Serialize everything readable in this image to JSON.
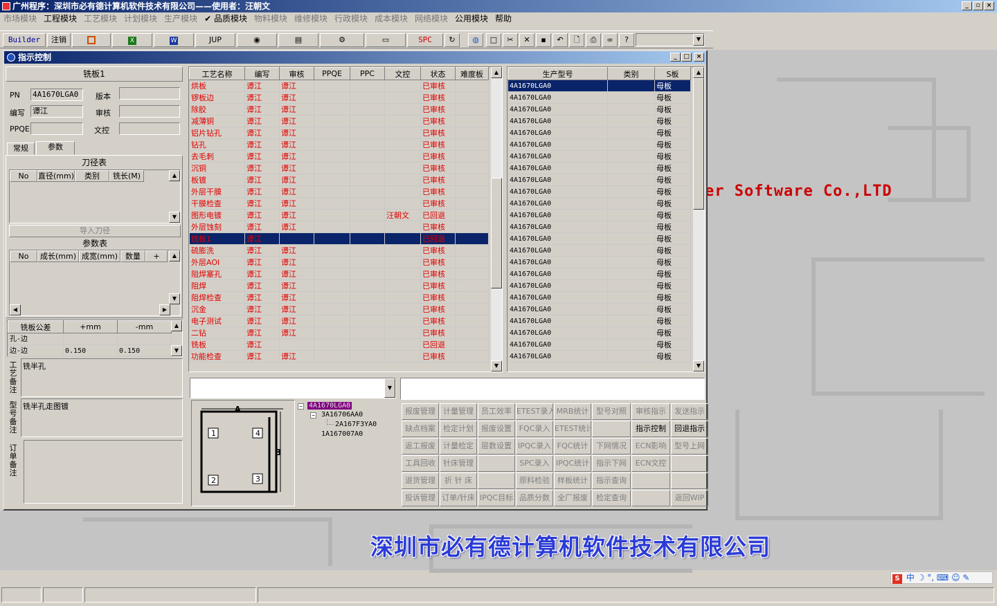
{
  "app": {
    "title": "广州程序：深圳市必有德计算机软件技术有限公司——使用者：汪朝文"
  },
  "menu": [
    {
      "label": "市场模块",
      "on": false
    },
    {
      "label": "工程模块",
      "on": true
    },
    {
      "label": "工艺模块",
      "on": false
    },
    {
      "label": "计划模块",
      "on": false
    },
    {
      "label": "生产模块",
      "on": false
    },
    {
      "label": "✔ 品质模块",
      "on": true
    },
    {
      "label": "物料模块",
      "on": false
    },
    {
      "label": "维修模块",
      "on": false
    },
    {
      "label": "行政模块",
      "on": false
    },
    {
      "label": "成本模块",
      "on": false
    },
    {
      "label": "网络模块",
      "on": false
    },
    {
      "label": "公用模块",
      "on": true
    },
    {
      "label": "帮助",
      "on": true
    }
  ],
  "toolbar": {
    "builder": "Builder",
    "logout": "注销",
    "jup": "JUP",
    "spc": "SPC"
  },
  "background": {
    "company_en": "er Software Co.,LTD",
    "company_cn": "深圳市必有德计算机软件技术有限公司"
  },
  "window": {
    "title": "指示控制"
  },
  "left": {
    "process_name": "铣板1",
    "pn_label": "PN",
    "pn_value": "4A1670LGA0",
    "version_label": "版本",
    "version_value": "",
    "editor_label": "编写",
    "editor_value": "谭江",
    "review_label": "审核",
    "review_value": "",
    "ppqe_label": "PPQE",
    "ppqe_value": "",
    "doc_label": "文控",
    "doc_value": "",
    "tabs": [
      "常规",
      "参数"
    ],
    "tool_table_title": "刀径表",
    "tool_headers": [
      "No",
      "直径(mm)",
      "类别",
      "铣长(M)"
    ],
    "import_btn": "导入刀径",
    "param_table_title": "参数表",
    "param_headers": [
      "No",
      "成长(mm)",
      "成宽(mm)",
      "数量",
      "+"
    ],
    "tol_headers": [
      "铣板公差",
      "+mm",
      "-mm"
    ],
    "tol_rows": [
      [
        "孔-边",
        "",
        ""
      ],
      [
        "边-边",
        "0.150",
        "0.150"
      ]
    ],
    "process_note_label": "工艺备注",
    "process_note": "铣半孔",
    "model_note_label": "型号备注",
    "model_note": "铣半孔走图镀",
    "order_note_label": "订单备注",
    "order_note": ""
  },
  "proc_table": {
    "headers": [
      "工艺名称",
      "编写",
      "审核",
      "PPQE",
      "PPC",
      "文控",
      "状态",
      "难度板"
    ],
    "rows": [
      [
        "烘板",
        "谭江",
        "谭江",
        "",
        "",
        "",
        "已审核",
        ""
      ],
      [
        "锣板边",
        "谭江",
        "谭江",
        "",
        "",
        "",
        "已审核",
        ""
      ],
      [
        "除胶",
        "谭江",
        "谭江",
        "",
        "",
        "",
        "已审核",
        ""
      ],
      [
        "减薄铜",
        "谭江",
        "谭江",
        "",
        "",
        "",
        "已审核",
        ""
      ],
      [
        "铝片钻孔",
        "谭江",
        "谭江",
        "",
        "",
        "",
        "已审核",
        ""
      ],
      [
        "钻孔",
        "谭江",
        "谭江",
        "",
        "",
        "",
        "已审核",
        ""
      ],
      [
        "去毛刺",
        "谭江",
        "谭江",
        "",
        "",
        "",
        "已审核",
        ""
      ],
      [
        "沉铜",
        "谭江",
        "谭江",
        "",
        "",
        "",
        "已审核",
        ""
      ],
      [
        "板镀",
        "谭江",
        "谭江",
        "",
        "",
        "",
        "已审核",
        ""
      ],
      [
        "外层干膜",
        "谭江",
        "谭江",
        "",
        "",
        "",
        "已审核",
        ""
      ],
      [
        "干膜检查",
        "谭江",
        "谭江",
        "",
        "",
        "",
        "已审核",
        ""
      ],
      [
        "图形电镀",
        "谭江",
        "谭江",
        "",
        "",
        "汪朝文",
        "已回退",
        ""
      ],
      [
        "外层蚀刻",
        "谭江",
        "谭江",
        "",
        "",
        "",
        "已审核",
        ""
      ],
      [
        "铣板1",
        "谭江",
        "",
        "",
        "",
        "",
        "已回退",
        ""
      ],
      [
        "硫膨洗",
        "谭江",
        "谭江",
        "",
        "",
        "",
        "已审核",
        ""
      ],
      [
        "外层AOI",
        "谭江",
        "谭江",
        "",
        "",
        "",
        "已审核",
        ""
      ],
      [
        "阻焊塞孔",
        "谭江",
        "谭江",
        "",
        "",
        "",
        "已审核",
        ""
      ],
      [
        "阻焊",
        "谭江",
        "谭江",
        "",
        "",
        "",
        "已审核",
        ""
      ],
      [
        "阻焊检查",
        "谭江",
        "谭江",
        "",
        "",
        "",
        "已审核",
        ""
      ],
      [
        "沉金",
        "谭江",
        "谭江",
        "",
        "",
        "",
        "已审核",
        ""
      ],
      [
        "电子测试",
        "谭江",
        "谭江",
        "",
        "",
        "",
        "已审核",
        ""
      ],
      [
        "二钻",
        "谭江",
        "谭江",
        "",
        "",
        "",
        "已审核",
        ""
      ],
      [
        "铣板",
        "谭江",
        "",
        "",
        "",
        "",
        "已回退",
        ""
      ],
      [
        "功能检查",
        "谭江",
        "谭江",
        "",
        "",
        "",
        "已审核",
        ""
      ]
    ],
    "selected": 13
  },
  "model_table": {
    "headers": [
      "生产型号",
      "类别",
      "S板"
    ],
    "rows": [
      [
        "4A1670LGA0",
        "",
        "母板"
      ],
      [
        "4A1670LGA0",
        "",
        "母板"
      ],
      [
        "4A1670LGA0",
        "",
        "母板"
      ],
      [
        "4A1670LGA0",
        "",
        "母板"
      ],
      [
        "4A1670LGA0",
        "",
        "母板"
      ],
      [
        "4A1670LGA0",
        "",
        "母板"
      ],
      [
        "4A1670LGA0",
        "",
        "母板"
      ],
      [
        "4A1670LGA0",
        "",
        "母板"
      ],
      [
        "4A1670LGA0",
        "",
        "母板"
      ],
      [
        "4A1670LGA0",
        "",
        "母板"
      ],
      [
        "4A1670LGA0",
        "",
        "母板"
      ],
      [
        "4A1670LGA0",
        "",
        "母板"
      ],
      [
        "4A1670LGA0",
        "",
        "母板"
      ],
      [
        "4A1670LGA0",
        "",
        "母板"
      ],
      [
        "4A1670LGA0",
        "",
        "母板"
      ],
      [
        "4A1670LGA0",
        "",
        "母板"
      ],
      [
        "4A1670LGA0",
        "",
        "母板"
      ],
      [
        "4A1670LGA0",
        "",
        "母板"
      ],
      [
        "4A1670LGA0",
        "",
        "母板"
      ],
      [
        "4A1670LGA0",
        "",
        "母板"
      ],
      [
        "4A1670LGA0",
        "",
        "母板"
      ],
      [
        "4A1670LGA0",
        "",
        "母板"
      ],
      [
        "4A1670LGA0",
        "",
        "母板"
      ],
      [
        "4A1670LGA0",
        "",
        "母板"
      ]
    ],
    "selected": 0
  },
  "diagram": {
    "a": "A",
    "b": "B",
    "corners": [
      "1",
      "4",
      "2",
      "3"
    ]
  },
  "tree": {
    "root": "4A1670LGA0",
    "children": [
      {
        "label": "3A16706AA0",
        "children": [
          {
            "label": "2A167F3YA0"
          }
        ]
      },
      {
        "label": "1A167007A0"
      }
    ]
  },
  "buttons": [
    [
      {
        "l": "报废管理",
        "on": false
      },
      {
        "l": "计量管理",
        "on": false
      },
      {
        "l": "员工效率",
        "on": false
      },
      {
        "l": "ETEST录入",
        "on": false
      },
      {
        "l": "MRB统计",
        "on": false
      },
      {
        "l": "型号对照",
        "on": false
      },
      {
        "l": "审核指示",
        "on": false
      },
      {
        "l": "发送指示",
        "on": false
      }
    ],
    [
      {
        "l": "缺点档案",
        "on": false
      },
      {
        "l": "检定计划",
        "on": false
      },
      {
        "l": "报废设置",
        "on": false
      },
      {
        "l": "FQC录入",
        "on": false
      },
      {
        "l": "ETEST统计",
        "on": false
      },
      {
        "l": "",
        "on": false
      },
      {
        "l": "指示控制",
        "on": true
      },
      {
        "l": "回退指示",
        "on": true
      }
    ],
    [
      {
        "l": "返工报废",
        "on": false
      },
      {
        "l": "计量检定",
        "on": false
      },
      {
        "l": "层数设置",
        "on": false
      },
      {
        "l": "IPQC录入",
        "on": false
      },
      {
        "l": "FQC统计",
        "on": false
      },
      {
        "l": "下网情况",
        "on": false
      },
      {
        "l": "ECN影响",
        "on": false
      },
      {
        "l": "型号上网",
        "on": false
      }
    ],
    [
      {
        "l": "工具回收",
        "on": false
      },
      {
        "l": "针床管理",
        "on": false
      },
      {
        "l": "",
        "on": false
      },
      {
        "l": "SPC录入",
        "on": false
      },
      {
        "l": "IPQC统计",
        "on": false
      },
      {
        "l": "指示下网",
        "on": false
      },
      {
        "l": "ECN文控",
        "on": false
      },
      {
        "l": "",
        "on": false
      }
    ],
    [
      {
        "l": "退货管理",
        "on": false
      },
      {
        "l": "折 针 床",
        "on": false
      },
      {
        "l": "",
        "on": false
      },
      {
        "l": "原料检验",
        "on": false
      },
      {
        "l": "样板统计",
        "on": false
      },
      {
        "l": "指示查询",
        "on": false
      },
      {
        "l": "",
        "on": false
      },
      {
        "l": "",
        "on": false
      }
    ],
    [
      {
        "l": "投诉管理",
        "on": false
      },
      {
        "l": "订单/针床",
        "on": false
      },
      {
        "l": "IPQC目标",
        "on": false
      },
      {
        "l": "品质分数",
        "on": false
      },
      {
        "l": "全厂报废",
        "on": false
      },
      {
        "l": "检定查询",
        "on": false
      },
      {
        "l": "",
        "on": false
      },
      {
        "l": "返回WIP",
        "on": false
      }
    ]
  ],
  "ime": {
    "label": "中"
  }
}
